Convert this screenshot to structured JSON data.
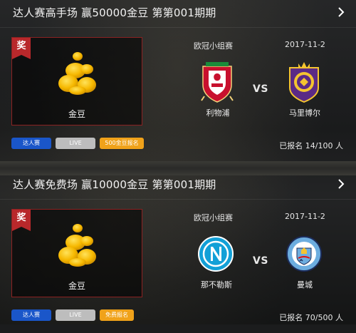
{
  "cards": [
    {
      "title": "达人赛高手场 赢50000金豆 第第001期期",
      "prize_badge": "奖",
      "prize_label": "金豆",
      "competition": "欧冠小组赛",
      "date": "2017-11-2",
      "home_team": "利物浦",
      "away_team": "马里博尔",
      "vs": "VS",
      "tags": [
        "达人赛",
        "LIVE",
        "500金豆报名"
      ],
      "registration": "已报名 14/100 人"
    },
    {
      "title": "达人赛免费场 赢10000金豆 第第001期期",
      "prize_badge": "奖",
      "prize_label": "金豆",
      "competition": "欧冠小组赛",
      "date": "2017-11-2",
      "home_team": "那不勒斯",
      "away_team": "曼城",
      "vs": "VS",
      "tags": [
        "达人赛",
        "LIVE",
        "免费报名"
      ],
      "registration": "已报名 70/500 人"
    }
  ],
  "colors": {
    "tag_blue": "#1a56c9",
    "tag_gray": "#bdbdbd",
    "tag_orange": "#f0a21a",
    "badge_red": "#b8282b"
  }
}
